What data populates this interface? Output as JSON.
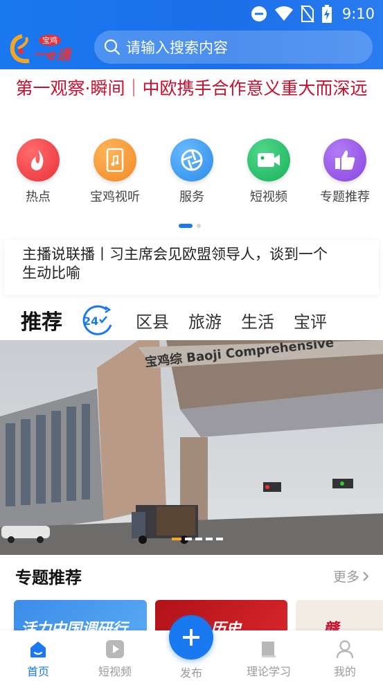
{
  "status_bar": {
    "time": "9:10"
  },
  "header": {
    "logo_text": "宝鸡一e通",
    "search_placeholder": "请输入搜索内容"
  },
  "headline": "第一观察·瞬间｜中欧携手合作意义重大而深远",
  "categories": [
    {
      "label": "热点",
      "icon": "flame-icon",
      "color": "#e8323a"
    },
    {
      "label": "宝鸡视听",
      "icon": "phone-music-icon",
      "color": "#f08a24"
    },
    {
      "label": "服务",
      "icon": "aperture-icon",
      "color": "#2a8de8"
    },
    {
      "label": "短视频",
      "icon": "video-camera-icon",
      "color": "#19b35a"
    },
    {
      "label": "专题推荐",
      "icon": "thumbs-up-icon",
      "color": "#8a45e0"
    }
  ],
  "news": {
    "text": "主播说联播丨习主席会见欧盟领导人，谈到一个生动比喻"
  },
  "tabs": {
    "recommend": "推荐",
    "badge_24": "24",
    "items": [
      "区县",
      "旅游",
      "生活",
      "宝评"
    ]
  },
  "banner": {
    "sign_text": "宝鸡综 Baoji Comprehensive"
  },
  "topics": {
    "title": "专题推荐",
    "more": "更多",
    "cards": [
      "活力中国调研行",
      "历史",
      "赣"
    ]
  },
  "bottom_nav": {
    "items": [
      {
        "label": "首页",
        "icon": "home-icon",
        "active": true
      },
      {
        "label": "短视频",
        "icon": "play-icon",
        "active": false
      },
      {
        "label": "发布",
        "icon": "plus-icon",
        "active": false
      },
      {
        "label": "理论学习",
        "icon": "book-icon",
        "active": false
      },
      {
        "label": "我的",
        "icon": "user-icon",
        "active": false
      }
    ]
  }
}
